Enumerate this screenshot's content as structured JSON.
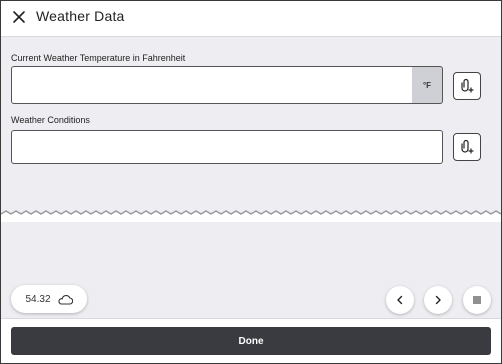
{
  "header": {
    "title": "Weather Data",
    "close_icon": "close-icon"
  },
  "fields": {
    "temperature": {
      "label": "Current Weather Temperature in Fahrenheit",
      "value": "",
      "unit": "°F",
      "attach_icon": "attach-file-icon"
    },
    "conditions": {
      "label": "Weather Conditions",
      "value": "",
      "attach_icon": "attach-file-icon"
    }
  },
  "status": {
    "value": "54.32",
    "icon": "cloud-icon"
  },
  "nav": {
    "prev_icon": "chevron-left-icon",
    "next_icon": "chevron-right-icon",
    "menu_icon": "menu-icon"
  },
  "footer": {
    "done_label": "Done"
  },
  "colors": {
    "background": "#eeedf1",
    "done_button": "#3a3b40",
    "unit_box": "#cfcfd6"
  }
}
